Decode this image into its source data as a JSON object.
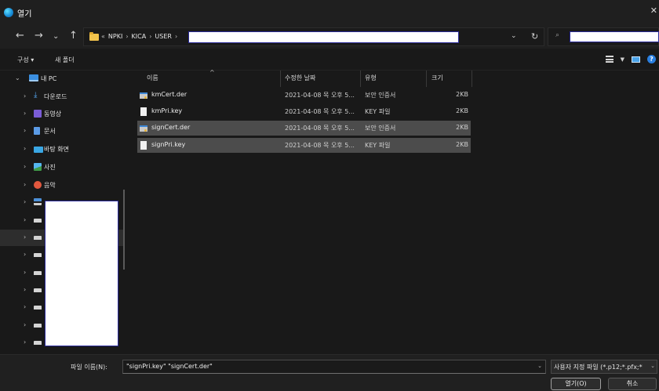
{
  "window": {
    "title": "열기"
  },
  "nav": {
    "back": "←",
    "forward": "→",
    "recent": "⌄",
    "up": "↑",
    "address_dropdown": "⌄",
    "refresh": "↻",
    "search_glyph": "⌕"
  },
  "address": {
    "overflow": "«",
    "crumbs": [
      "NPKI",
      "KICA",
      "USER"
    ],
    "separator": "›"
  },
  "toolbar": {
    "organize": "구성 ▾",
    "new_folder": "새 폴더"
  },
  "sidebar": {
    "items": [
      {
        "label": "내 PC",
        "icon": "pc-icon"
      },
      {
        "label": "다운로드",
        "icon": "download-icon"
      },
      {
        "label": "동영상",
        "icon": "video-icon"
      },
      {
        "label": "문서",
        "icon": "document-icon"
      },
      {
        "label": "바탕 화면",
        "icon": "desktop-icon"
      },
      {
        "label": "사진",
        "icon": "pictures-icon"
      },
      {
        "label": "음악",
        "icon": "music-icon"
      }
    ],
    "chev_right": "›",
    "chev_down": "⌄"
  },
  "columns": {
    "name": "이름",
    "date": "수정한 날짜",
    "type": "유형",
    "size": "크기",
    "sort_caret": "^"
  },
  "files": [
    {
      "name": "kmCert.der",
      "date": "2021-04-08 목 오후 5...",
      "type": "보안 인증서",
      "size": "2KB",
      "icon": "certificate-icon",
      "selected": false
    },
    {
      "name": "kmPri.key",
      "date": "2021-04-08 목 오후 5...",
      "type": "KEY 파일",
      "size": "2KB",
      "icon": "key-file-icon",
      "selected": false
    },
    {
      "name": "signCert.der",
      "date": "2021-04-08 목 오후 5...",
      "type": "보안 인증서",
      "size": "2KB",
      "icon": "certificate-icon",
      "selected": true
    },
    {
      "name": "signPri.key",
      "date": "2021-04-08 목 오후 5...",
      "type": "KEY 파일",
      "size": "2KB",
      "icon": "key-file-icon",
      "selected": true
    }
  ],
  "bottom": {
    "filename_label": "파일 이름(N):",
    "filename_value": "\"signPri.key\" \"signCert.der\"",
    "filter_value": "사용자 지정 파일 (*.p12;*.pfx;*",
    "dropdown_glyph": "⌄",
    "open_label": "열기(O)",
    "cancel_label": "취소"
  },
  "colors": {
    "background": "#191919",
    "selection": "#4c4c4c",
    "accent": "#3b8fe0"
  }
}
